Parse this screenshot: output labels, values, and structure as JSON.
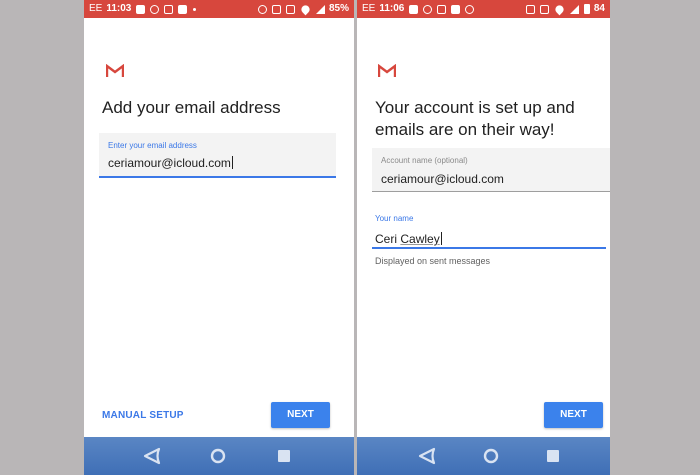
{
  "left": {
    "status": {
      "carrier": "EE",
      "time": "11:03",
      "battery": "85%"
    },
    "title": "Add your email address",
    "email_field": {
      "label": "Enter your email address",
      "value": "ceriamour@icloud.com"
    },
    "manual_setup_label": "MANUAL SETUP",
    "next_label": "NEXT"
  },
  "right": {
    "status": {
      "carrier": "EE",
      "time": "11:06",
      "battery": "84"
    },
    "title_line1": "Your account is set up and",
    "title_line2": "emails are on their way!",
    "account_name_field": {
      "label": "Account name (optional)",
      "value": "ceriamour@icloud.com"
    },
    "your_name_field": {
      "label": "Your name",
      "value_first": "Ceri",
      "value_last": "Cawley"
    },
    "helper_text": "Displayed on sent messages",
    "next_label": "NEXT"
  },
  "colors": {
    "status_bar": "#d7473d",
    "accent_blue": "#3b78e7",
    "nav_bar": "#4a7bbf",
    "background": "#b9b6b7"
  },
  "icons": {
    "logo": "gmail-logo-icon",
    "nav_back": "back-triangle-icon",
    "nav_home": "home-circle-icon",
    "nav_recents": "recents-square-icon"
  }
}
